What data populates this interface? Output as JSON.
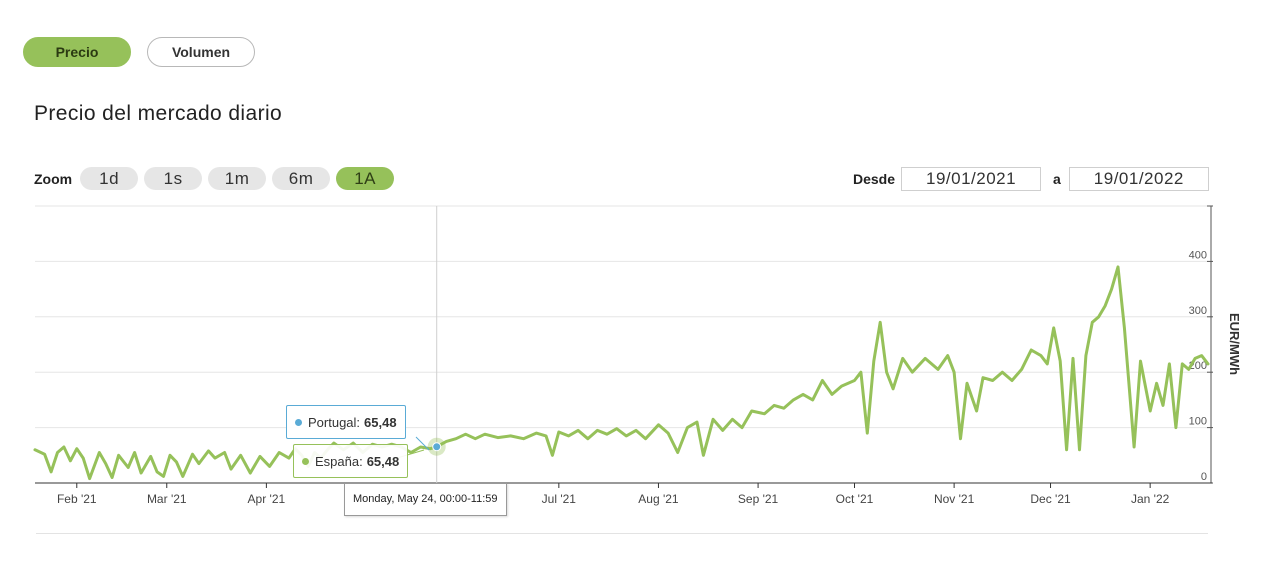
{
  "tabs": {
    "price": "Precio",
    "volume": "Volumen"
  },
  "title": "Precio del mercado diario",
  "zoom": {
    "label": "Zoom",
    "options": [
      "1d",
      "1s",
      "1m",
      "6m",
      "1A"
    ],
    "active": "1A"
  },
  "range": {
    "from_label": "Desde",
    "from": "19/01/2021",
    "to_label": "a",
    "to": "19/01/2022"
  },
  "colors": {
    "accent": "#96c15a",
    "portugal": "#5aabd6",
    "espana": "#96c15a"
  },
  "tooltip": {
    "portugal_label": "Portugal:",
    "portugal_value": "65,48",
    "espana_label": "España:",
    "espana_value": "65,48",
    "date": "Monday, May 24, 00:00-11:59"
  },
  "chart_data": {
    "type": "line",
    "ylabel": "EUR/MWh",
    "ylim": [
      0,
      400
    ],
    "yticks": [
      0,
      100,
      200,
      300,
      400
    ],
    "y_axis_position": "right",
    "xlim": [
      "2021-01-19",
      "2022-01-19"
    ],
    "xticks": [
      {
        "date": "2021-02-01",
        "label": "Feb '21"
      },
      {
        "date": "2021-03-01",
        "label": "Mar '21"
      },
      {
        "date": "2021-04-01",
        "label": "Apr '21"
      },
      {
        "date": "2021-07-01",
        "label": "Jul '21"
      },
      {
        "date": "2021-08-01",
        "label": "Aug '21"
      },
      {
        "date": "2021-09-01",
        "label": "Sep '21"
      },
      {
        "date": "2021-10-01",
        "label": "Oct '21"
      },
      {
        "date": "2021-11-01",
        "label": "Nov '21"
      },
      {
        "date": "2021-12-01",
        "label": "Dec '21"
      },
      {
        "date": "2022-01-01",
        "label": "Jan '22"
      }
    ],
    "grid": true,
    "highlight": {
      "date": "2021-05-24",
      "value": 65.48
    },
    "series": [
      {
        "name": "España",
        "points": [
          [
            "2021-01-19",
            60
          ],
          [
            "2021-01-22",
            52
          ],
          [
            "2021-01-24",
            20
          ],
          [
            "2021-01-26",
            55
          ],
          [
            "2021-01-28",
            65
          ],
          [
            "2021-01-30",
            40
          ],
          [
            "2021-02-01",
            62
          ],
          [
            "2021-02-03",
            45
          ],
          [
            "2021-02-05",
            8
          ],
          [
            "2021-02-08",
            55
          ],
          [
            "2021-02-10",
            35
          ],
          [
            "2021-02-12",
            10
          ],
          [
            "2021-02-14",
            50
          ],
          [
            "2021-02-17",
            28
          ],
          [
            "2021-02-19",
            55
          ],
          [
            "2021-02-21",
            18
          ],
          [
            "2021-02-24",
            48
          ],
          [
            "2021-02-26",
            20
          ],
          [
            "2021-02-28",
            12
          ],
          [
            "2021-03-02",
            50
          ],
          [
            "2021-03-04",
            38
          ],
          [
            "2021-03-06",
            12
          ],
          [
            "2021-03-09",
            52
          ],
          [
            "2021-03-11",
            35
          ],
          [
            "2021-03-14",
            58
          ],
          [
            "2021-03-16",
            45
          ],
          [
            "2021-03-19",
            55
          ],
          [
            "2021-03-21",
            25
          ],
          [
            "2021-03-24",
            50
          ],
          [
            "2021-03-27",
            18
          ],
          [
            "2021-03-30",
            48
          ],
          [
            "2021-04-02",
            30
          ],
          [
            "2021-04-05",
            55
          ],
          [
            "2021-04-08",
            45
          ],
          [
            "2021-04-10",
            62
          ],
          [
            "2021-04-12",
            50
          ],
          [
            "2021-04-14",
            30
          ],
          [
            "2021-04-16",
            55
          ],
          [
            "2021-04-18",
            45
          ],
          [
            "2021-04-20",
            60
          ],
          [
            "2021-04-22",
            72
          ],
          [
            "2021-04-25",
            60
          ],
          [
            "2021-04-28",
            72
          ],
          [
            "2021-05-01",
            55
          ],
          [
            "2021-05-04",
            70
          ],
          [
            "2021-05-07",
            65
          ],
          [
            "2021-05-10",
            70
          ],
          [
            "2021-05-13",
            65
          ],
          [
            "2021-05-16",
            55
          ],
          [
            "2021-05-19",
            65
          ],
          [
            "2021-05-22",
            62
          ],
          [
            "2021-05-24",
            65.48
          ],
          [
            "2021-05-27",
            75
          ],
          [
            "2021-05-30",
            80
          ],
          [
            "2021-06-02",
            88
          ],
          [
            "2021-06-05",
            80
          ],
          [
            "2021-06-08",
            88
          ],
          [
            "2021-06-12",
            82
          ],
          [
            "2021-06-16",
            85
          ],
          [
            "2021-06-20",
            80
          ],
          [
            "2021-06-24",
            90
          ],
          [
            "2021-06-27",
            85
          ],
          [
            "2021-06-29",
            50
          ],
          [
            "2021-07-01",
            92
          ],
          [
            "2021-07-04",
            85
          ],
          [
            "2021-07-07",
            95
          ],
          [
            "2021-07-10",
            80
          ],
          [
            "2021-07-13",
            95
          ],
          [
            "2021-07-16",
            88
          ],
          [
            "2021-07-19",
            98
          ],
          [
            "2021-07-22",
            85
          ],
          [
            "2021-07-25",
            95
          ],
          [
            "2021-07-28",
            80
          ],
          [
            "2021-08-01",
            105
          ],
          [
            "2021-08-04",
            90
          ],
          [
            "2021-08-07",
            55
          ],
          [
            "2021-08-10",
            100
          ],
          [
            "2021-08-13",
            110
          ],
          [
            "2021-08-15",
            50
          ],
          [
            "2021-08-18",
            115
          ],
          [
            "2021-08-21",
            95
          ],
          [
            "2021-08-24",
            115
          ],
          [
            "2021-08-27",
            100
          ],
          [
            "2021-08-30",
            130
          ],
          [
            "2021-09-03",
            125
          ],
          [
            "2021-09-06",
            140
          ],
          [
            "2021-09-09",
            135
          ],
          [
            "2021-09-12",
            150
          ],
          [
            "2021-09-15",
            160
          ],
          [
            "2021-09-18",
            150
          ],
          [
            "2021-09-21",
            185
          ],
          [
            "2021-09-24",
            160
          ],
          [
            "2021-09-27",
            175
          ],
          [
            "2021-10-01",
            185
          ],
          [
            "2021-10-03",
            200
          ],
          [
            "2021-10-05",
            90
          ],
          [
            "2021-10-07",
            220
          ],
          [
            "2021-10-09",
            290
          ],
          [
            "2021-10-11",
            200
          ],
          [
            "2021-10-13",
            170
          ],
          [
            "2021-10-16",
            225
          ],
          [
            "2021-10-19",
            200
          ],
          [
            "2021-10-23",
            225
          ],
          [
            "2021-10-27",
            205
          ],
          [
            "2021-10-30",
            230
          ],
          [
            "2021-11-01",
            200
          ],
          [
            "2021-11-03",
            80
          ],
          [
            "2021-11-05",
            180
          ],
          [
            "2021-11-08",
            130
          ],
          [
            "2021-11-10",
            190
          ],
          [
            "2021-11-13",
            185
          ],
          [
            "2021-11-16",
            200
          ],
          [
            "2021-11-19",
            185
          ],
          [
            "2021-11-22",
            205
          ],
          [
            "2021-11-25",
            240
          ],
          [
            "2021-11-28",
            230
          ],
          [
            "2021-11-30",
            215
          ],
          [
            "2021-12-02",
            280
          ],
          [
            "2021-12-04",
            220
          ],
          [
            "2021-12-06",
            60
          ],
          [
            "2021-12-08",
            225
          ],
          [
            "2021-12-10",
            60
          ],
          [
            "2021-12-12",
            230
          ],
          [
            "2021-12-14",
            290
          ],
          [
            "2021-12-16",
            300
          ],
          [
            "2021-12-18",
            320
          ],
          [
            "2021-12-20",
            350
          ],
          [
            "2021-12-22",
            390
          ],
          [
            "2021-12-24",
            280
          ],
          [
            "2021-12-27",
            65
          ],
          [
            "2021-12-29",
            220
          ],
          [
            "2022-01-01",
            130
          ],
          [
            "2022-01-03",
            180
          ],
          [
            "2022-01-05",
            140
          ],
          [
            "2022-01-07",
            215
          ],
          [
            "2022-01-09",
            100
          ],
          [
            "2022-01-11",
            215
          ],
          [
            "2022-01-13",
            205
          ],
          [
            "2022-01-15",
            225
          ],
          [
            "2022-01-17",
            230
          ],
          [
            "2022-01-19",
            215
          ]
        ]
      }
    ]
  }
}
